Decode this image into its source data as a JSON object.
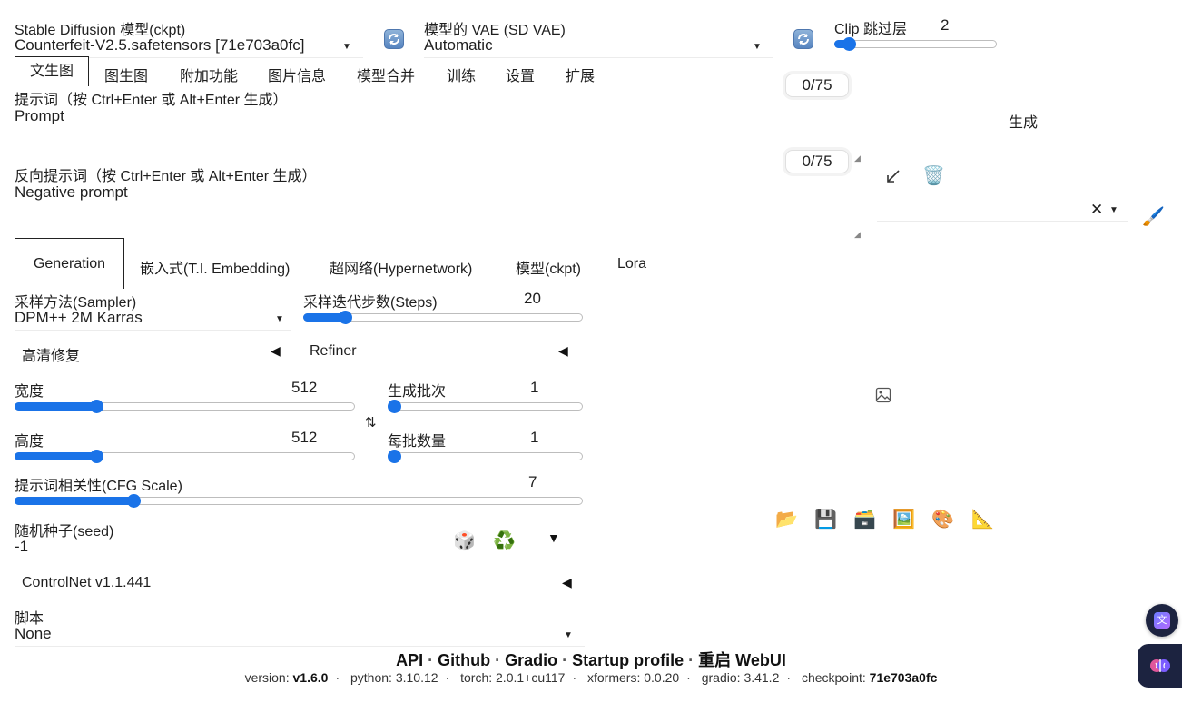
{
  "top": {
    "ckpt_label": "Stable Diffusion 模型(ckpt)",
    "ckpt_value": "Counterfeit-V2.5.safetensors [71e703a0fc]",
    "vae_label": "模型的 VAE (SD VAE)",
    "vae_value": "Automatic",
    "clip_label": "Clip 跳过层",
    "clip_value": "2",
    "clip_fraction": 0.09
  },
  "tabs": [
    "文生图",
    "图生图",
    "附加功能",
    "图片信息",
    "模型合并",
    "训练",
    "设置",
    "扩展"
  ],
  "prompt": {
    "label": "提示词（按 Ctrl+Enter 或 Alt+Enter 生成）",
    "placeholder": "Prompt",
    "counter": "0/75"
  },
  "negative": {
    "label": "反向提示词（按 Ctrl+Enter 或 Alt+Enter 生成）",
    "placeholder": "Negative prompt",
    "counter": "0/75"
  },
  "generate_label": "生成",
  "subtabs": [
    "Generation",
    "嵌入式(T.I. Embedding)",
    "超网络(Hypernetwork)",
    "模型(ckpt)",
    "Lora"
  ],
  "sampler": {
    "label": "采样方法(Sampler)",
    "value": "DPM++ 2M Karras"
  },
  "steps": {
    "label": "采样迭代步数(Steps)",
    "value": "20",
    "fraction": 0.15
  },
  "hires_label": "高清修复",
  "refiner_label": "Refiner",
  "width": {
    "label": "宽度",
    "value": "512",
    "fraction": 0.24
  },
  "height": {
    "label": "高度",
    "value": "512",
    "fraction": 0.24
  },
  "batch_count": {
    "label": "生成批次",
    "value": "1",
    "fraction": 0.0
  },
  "batch_size": {
    "label": "每批数量",
    "value": "1",
    "fraction": 0.0
  },
  "cfg": {
    "label": "提示词相关性(CFG Scale)",
    "value": "7",
    "fraction": 0.21
  },
  "seed": {
    "label": "随机种子(seed)",
    "value": "-1"
  },
  "controlnet_label": "ControlNet v1.1.441",
  "script": {
    "label": "脚本",
    "value": "None"
  },
  "footer": {
    "links": [
      "API",
      "Github",
      "Gradio",
      "Startup profile",
      "重启 WebUI"
    ],
    "versions": [
      {
        "key": "version:",
        "val": "v1.6.0",
        "bold": true
      },
      {
        "key": "python:",
        "val": "3.10.12",
        "bold": false
      },
      {
        "key": "torch:",
        "val": "2.0.1+cu117",
        "bold": false
      },
      {
        "key": "xformers:",
        "val": "0.0.20",
        "bold": false
      },
      {
        "key": "gradio:",
        "val": "3.41.2",
        "bold": false
      },
      {
        "key": "checkpoint:",
        "val": "71e703a0fc",
        "bold": true
      }
    ]
  },
  "colors": {
    "accent": "#1a73e8",
    "tab_border": "#222222"
  }
}
